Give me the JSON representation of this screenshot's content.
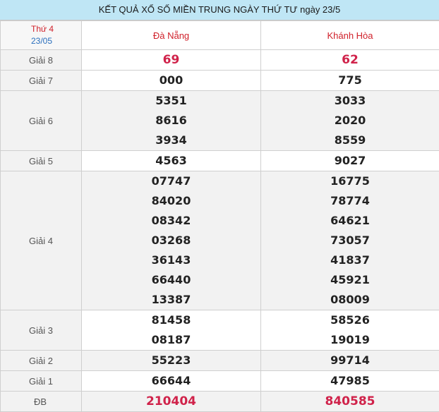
{
  "title": "KẾT QUẢ XỔ SỐ MIỀN TRUNG NGÀY THỨ TƯ ngày 23/5",
  "header": {
    "day": "Thứ 4",
    "date": "23/05",
    "prov1": "Đà Nẵng",
    "prov2": "Khánh Hòa"
  },
  "rows": [
    {
      "label": "Giải 8",
      "a": [
        "69"
      ],
      "b": [
        "62"
      ]
    },
    {
      "label": "Giải 7",
      "a": [
        "000"
      ],
      "b": [
        "775"
      ]
    },
    {
      "label": "Giải 6",
      "a": [
        "5351",
        "8616",
        "3934"
      ],
      "b": [
        "3033",
        "2020",
        "8559"
      ]
    },
    {
      "label": "Giải 5",
      "a": [
        "4563"
      ],
      "b": [
        "9027"
      ]
    },
    {
      "label": "Giải 4",
      "a": [
        "07747",
        "84020",
        "08342",
        "03268",
        "36143",
        "66440",
        "13387"
      ],
      "b": [
        "16775",
        "78774",
        "64621",
        "73057",
        "41837",
        "45921",
        "08009"
      ]
    },
    {
      "label": "Giải 3",
      "a": [
        "81458",
        "08187"
      ],
      "b": [
        "58526",
        "19019"
      ]
    },
    {
      "label": "Giải 2",
      "a": [
        "55223"
      ],
      "b": [
        "99714"
      ]
    },
    {
      "label": "Giải 1",
      "a": [
        "66644"
      ],
      "b": [
        "47985"
      ]
    },
    {
      "label": "ĐB",
      "a": [
        "210404"
      ],
      "b": [
        "840585"
      ]
    }
  ]
}
